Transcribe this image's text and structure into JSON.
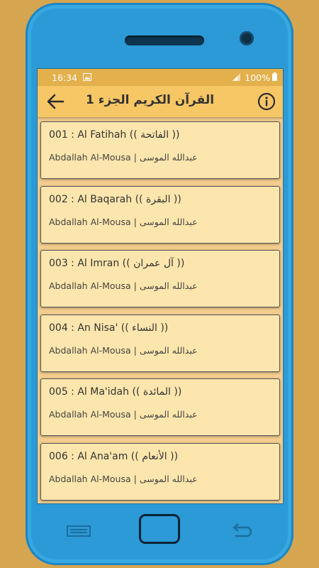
{
  "statusbar": {
    "time": "16:34",
    "battery": "100%"
  },
  "appbar": {
    "title": "القرآن الكريم الجزء 1"
  },
  "surahs": [
    {
      "title": "001 : Al Fatihah (( الفاتحة ))",
      "reciter": "Abdallah Al-Mousa | عبدالله الموسى"
    },
    {
      "title": "002 : Al Baqarah (( البقرة ))",
      "reciter": "Abdallah Al-Mousa | عبدالله الموسى"
    },
    {
      "title": "003 : Al Imran (( آل عمران ))",
      "reciter": "Abdallah Al-Mousa | عبدالله الموسى"
    },
    {
      "title": "004 : An Nisa' (( النساء ))",
      "reciter": "Abdallah Al-Mousa | عبدالله الموسى"
    },
    {
      "title": "005 : Al Ma'idah (( المائدة ))",
      "reciter": "Abdallah Al-Mousa | عبدالله الموسى"
    },
    {
      "title": "006 :  Al Ana'am (( الأنعام ))",
      "reciter": "Abdallah Al-Mousa | عبدالله الموسى"
    }
  ],
  "icons": {
    "back": "arrow-left-icon",
    "info": "info-icon",
    "image": "image-icon",
    "signal": "signal-icon",
    "battery": "battery-icon"
  },
  "colors": {
    "background": "#d6a54f",
    "phone": "#2b9ad6",
    "appbar": "#f7c766",
    "card": "#fde6ad"
  }
}
